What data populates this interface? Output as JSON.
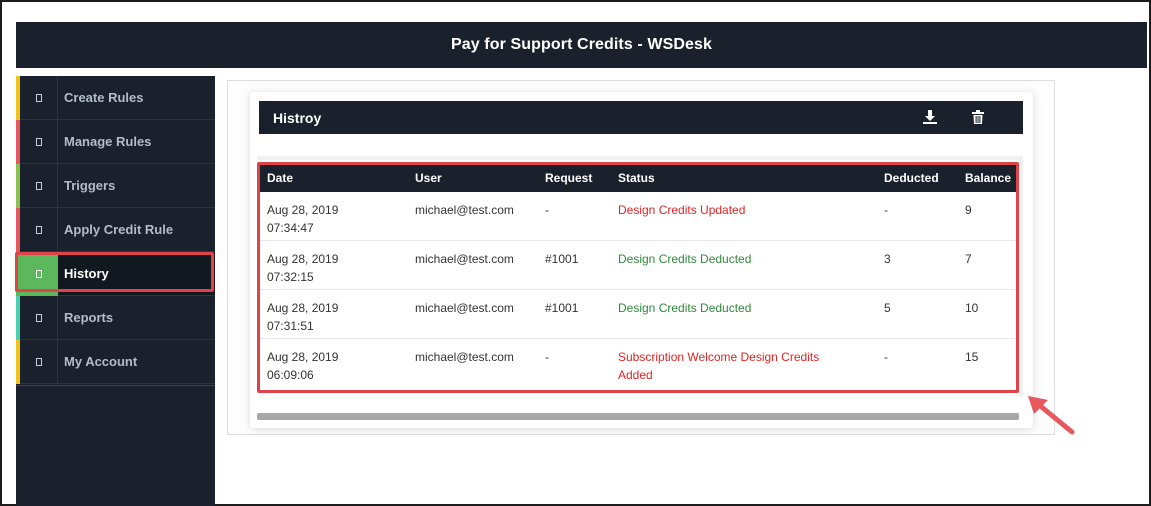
{
  "app": {
    "title": "Pay for Support Credits - WSDesk"
  },
  "sidebar": {
    "items": [
      {
        "label": "Create Rules",
        "color": "#f0c419"
      },
      {
        "label": "Manage Rules",
        "color": "#e8565e"
      },
      {
        "label": "Triggers",
        "color": "#8cc152"
      },
      {
        "label": "Apply Credit Rule",
        "color": "#e8565e"
      },
      {
        "label": "History",
        "color": "#5cb85c"
      },
      {
        "label": "Reports",
        "color": "#48cfad"
      },
      {
        "label": "My Account",
        "color": "#f0c419"
      }
    ],
    "active": "History"
  },
  "panel": {
    "title": "Histroy",
    "download_icon": "download-icon",
    "delete_icon": "trash-icon"
  },
  "table": {
    "columns": [
      "Date",
      "User",
      "Request",
      "Status",
      "Deducted",
      "Balance"
    ],
    "rows": [
      {
        "date": "Aug 28, 2019",
        "time": "07:34:47",
        "user": "michael@test.com",
        "request": "-",
        "status_line1": "Design Credits Updated",
        "status_line2": "",
        "status_color": "#e02424",
        "deducted": "-",
        "balance": "9"
      },
      {
        "date": "Aug 28, 2019",
        "time": "07:32:15",
        "user": "michael@test.com",
        "request": "#1001",
        "status_line1": "Design Credits Deducted",
        "status_line2": "",
        "status_color": "#2f8a3b",
        "deducted": "3",
        "balance": "7"
      },
      {
        "date": "Aug 28, 2019",
        "time": "07:31:51",
        "user": "michael@test.com",
        "request": "#1001",
        "status_line1": "Design Credits Deducted",
        "status_line2": "",
        "status_color": "#2f8a3b",
        "deducted": "5",
        "balance": "10"
      },
      {
        "date": "Aug 28, 2019",
        "time": "06:09:06",
        "user": "michael@test.com",
        "request": "-",
        "status_line1": "Subscription Welcome Design Credits",
        "status_line2": "Added",
        "status_color": "#e02424",
        "deducted": "-",
        "balance": "15"
      }
    ]
  },
  "colors": {
    "dark": "#1a212c",
    "highlight": "#e0434a",
    "active_green": "#5cb85c"
  }
}
